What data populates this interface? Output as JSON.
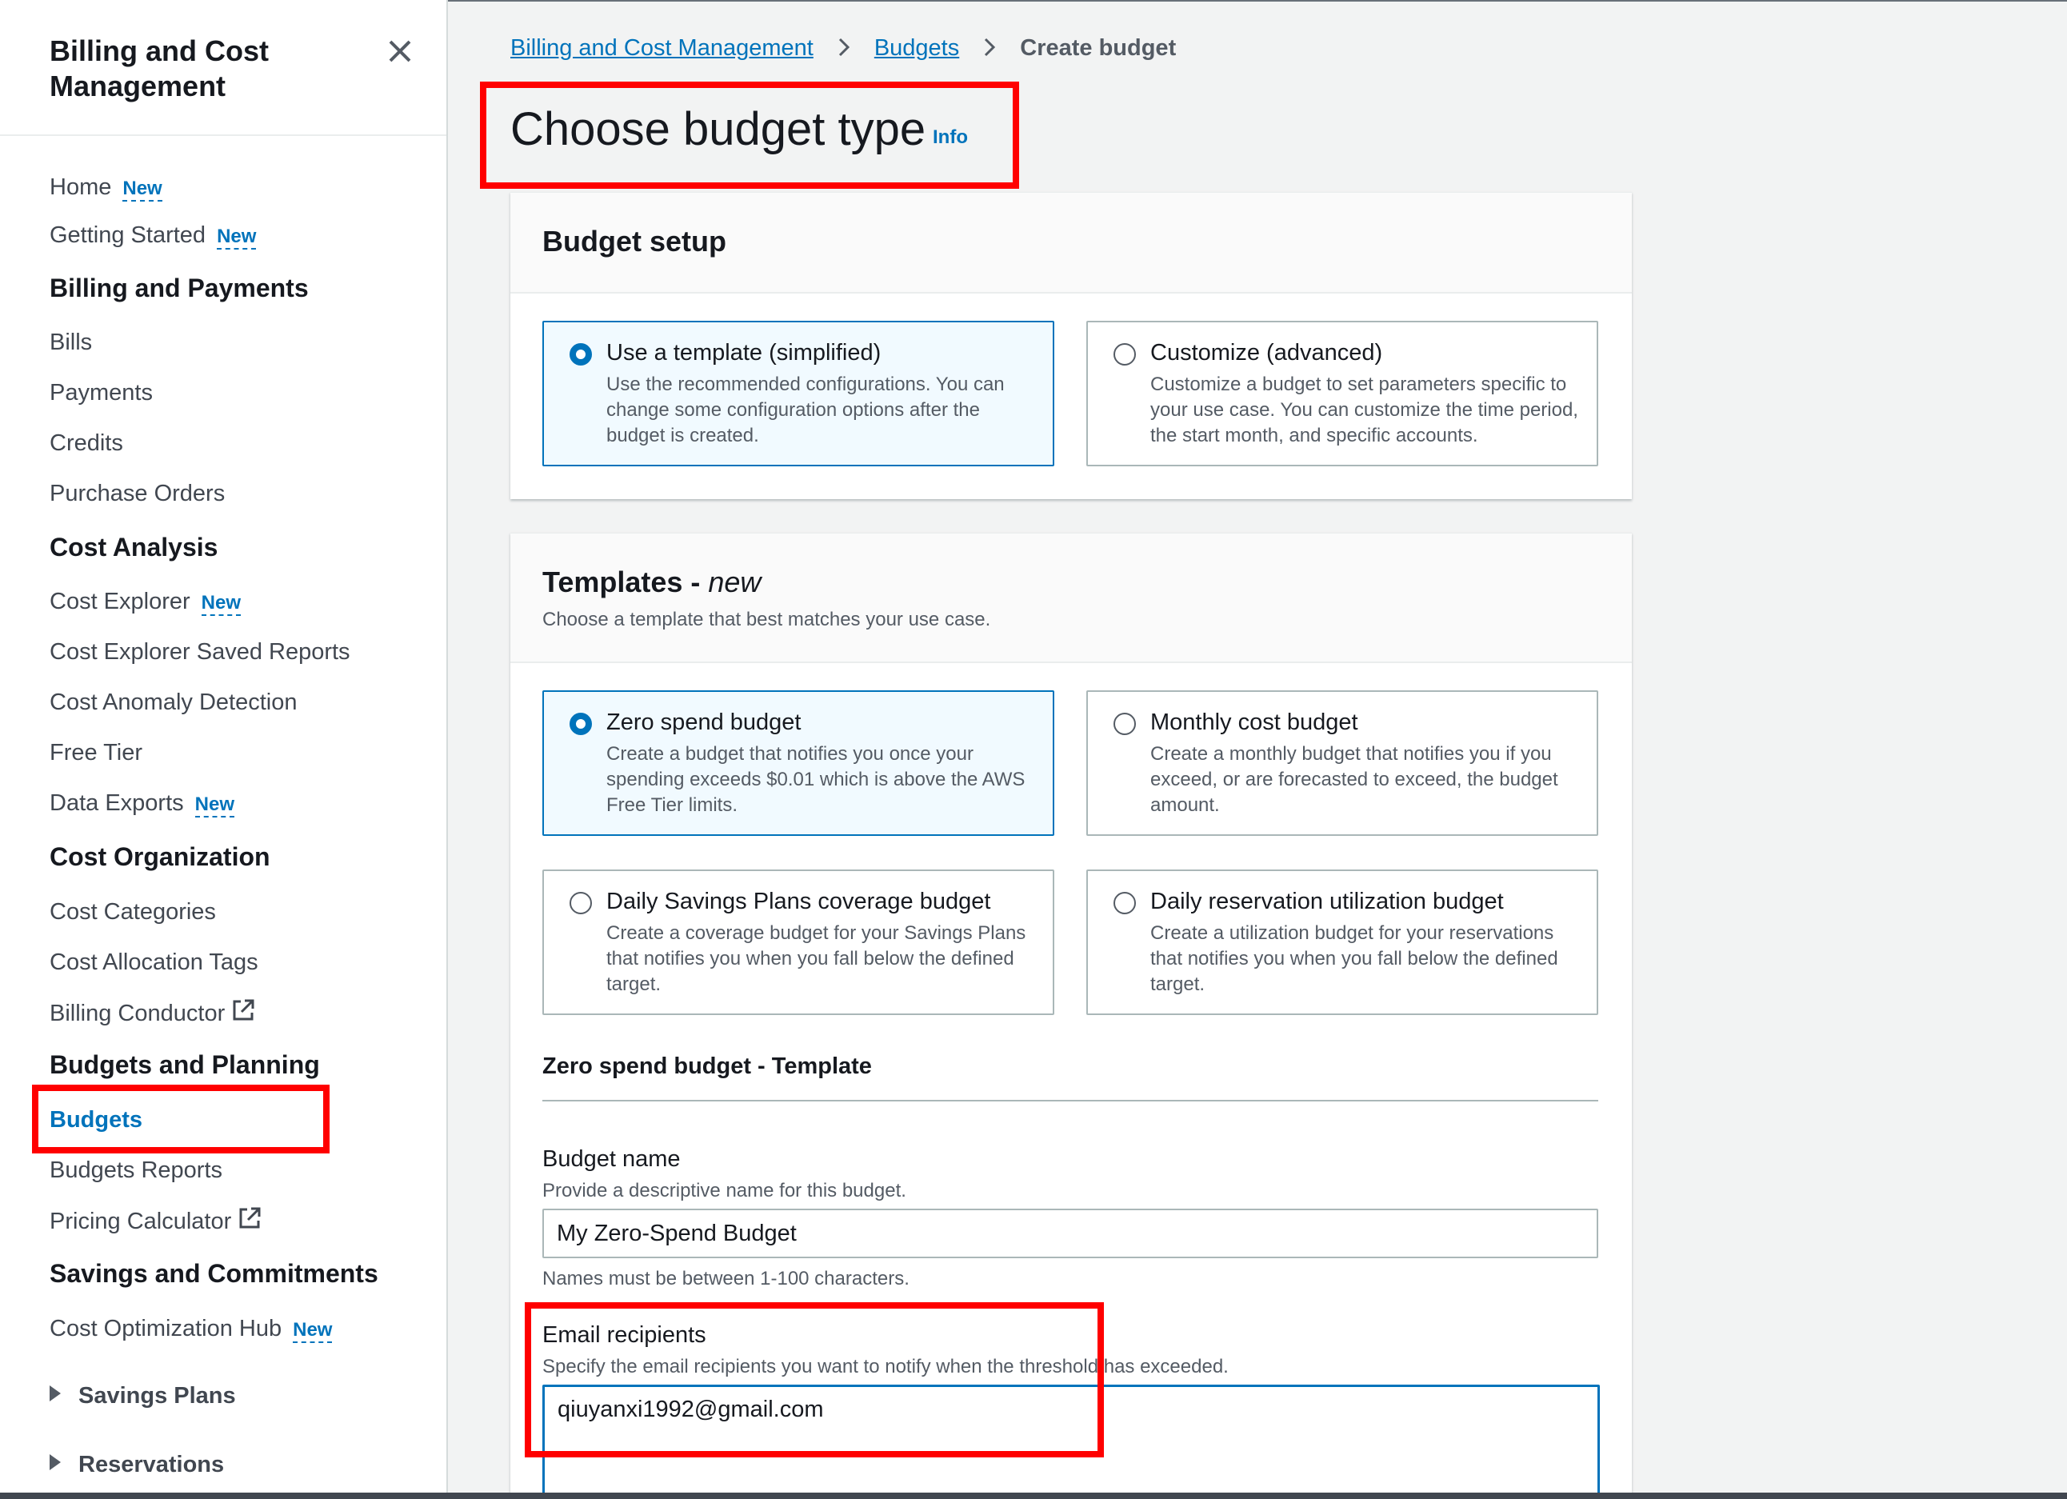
{
  "sidebar": {
    "title": "Billing and Cost Management",
    "new_badge": "New",
    "items": {
      "home": "Home",
      "getting_started": "Getting Started",
      "section_billing": "Billing and Payments",
      "bills": "Bills",
      "payments": "Payments",
      "credits": "Credits",
      "purchase_orders": "Purchase Orders",
      "section_cost_analysis": "Cost Analysis",
      "cost_explorer": "Cost Explorer",
      "saved_reports": "Cost Explorer Saved Reports",
      "anomaly_detection": "Cost Anomaly Detection",
      "free_tier": "Free Tier",
      "data_exports": "Data Exports",
      "section_cost_org": "Cost Organization",
      "cost_categories": "Cost Categories",
      "allocation_tags": "Cost Allocation Tags",
      "billing_conductor": "Billing Conductor",
      "section_budgets": "Budgets and Planning",
      "budgets": "Budgets",
      "budgets_reports": "Budgets Reports",
      "pricing_calculator": "Pricing Calculator",
      "section_savings": "Savings and Commitments",
      "optimization_hub": "Cost Optimization Hub",
      "savings_plans": "Savings Plans",
      "reservations": "Reservations"
    }
  },
  "breadcrumb": {
    "level1": "Billing and Cost Management",
    "level2": "Budgets",
    "current": "Create budget"
  },
  "page": {
    "title": "Choose budget type",
    "info": "Info"
  },
  "budget_setup": {
    "title": "Budget setup",
    "options": [
      {
        "title": "Use a template (simplified)",
        "desc": "Use the recommended configurations. You can change some configuration options after the budget is created.",
        "selected": true
      },
      {
        "title": "Customize (advanced)",
        "desc": "Customize a budget to set parameters specific to your use case. You can customize the time period, the start month, and specific accounts.",
        "selected": false
      }
    ]
  },
  "templates": {
    "title": "Templates - ",
    "title_em": "new",
    "desc": "Choose a template that best matches your use case.",
    "options": [
      {
        "title": "Zero spend budget",
        "desc": "Create a budget that notifies you once your spending exceeds $0.01 which is above the AWS Free Tier limits.",
        "selected": true
      },
      {
        "title": "Monthly cost budget",
        "desc": "Create a monthly budget that notifies you if you exceed, or are forecasted to exceed, the budget amount.",
        "selected": false
      },
      {
        "title": "Daily Savings Plans coverage budget",
        "desc": "Create a coverage budget for your Savings Plans that notifies you when you fall below the defined target.",
        "selected": false
      },
      {
        "title": "Daily reservation utilization budget",
        "desc": "Create a utilization budget for your reservations that notifies you when you fall below the defined target.",
        "selected": false
      }
    ],
    "section_title": "Zero spend budget - Template",
    "budget_name_label": "Budget name",
    "budget_name_desc": "Provide a descriptive name for this budget.",
    "budget_name_value": "My Zero-Spend Budget",
    "budget_name_hint": "Names must be between 1-100 characters.",
    "email_label": "Email recipients",
    "email_desc": "Specify the email recipients you want to notify when the threshold has exceeded.",
    "email_value": "qiuyanxi1992@gmail.com"
  },
  "colors": {
    "accent": "#0073bb",
    "annotation": "#ff0000"
  }
}
